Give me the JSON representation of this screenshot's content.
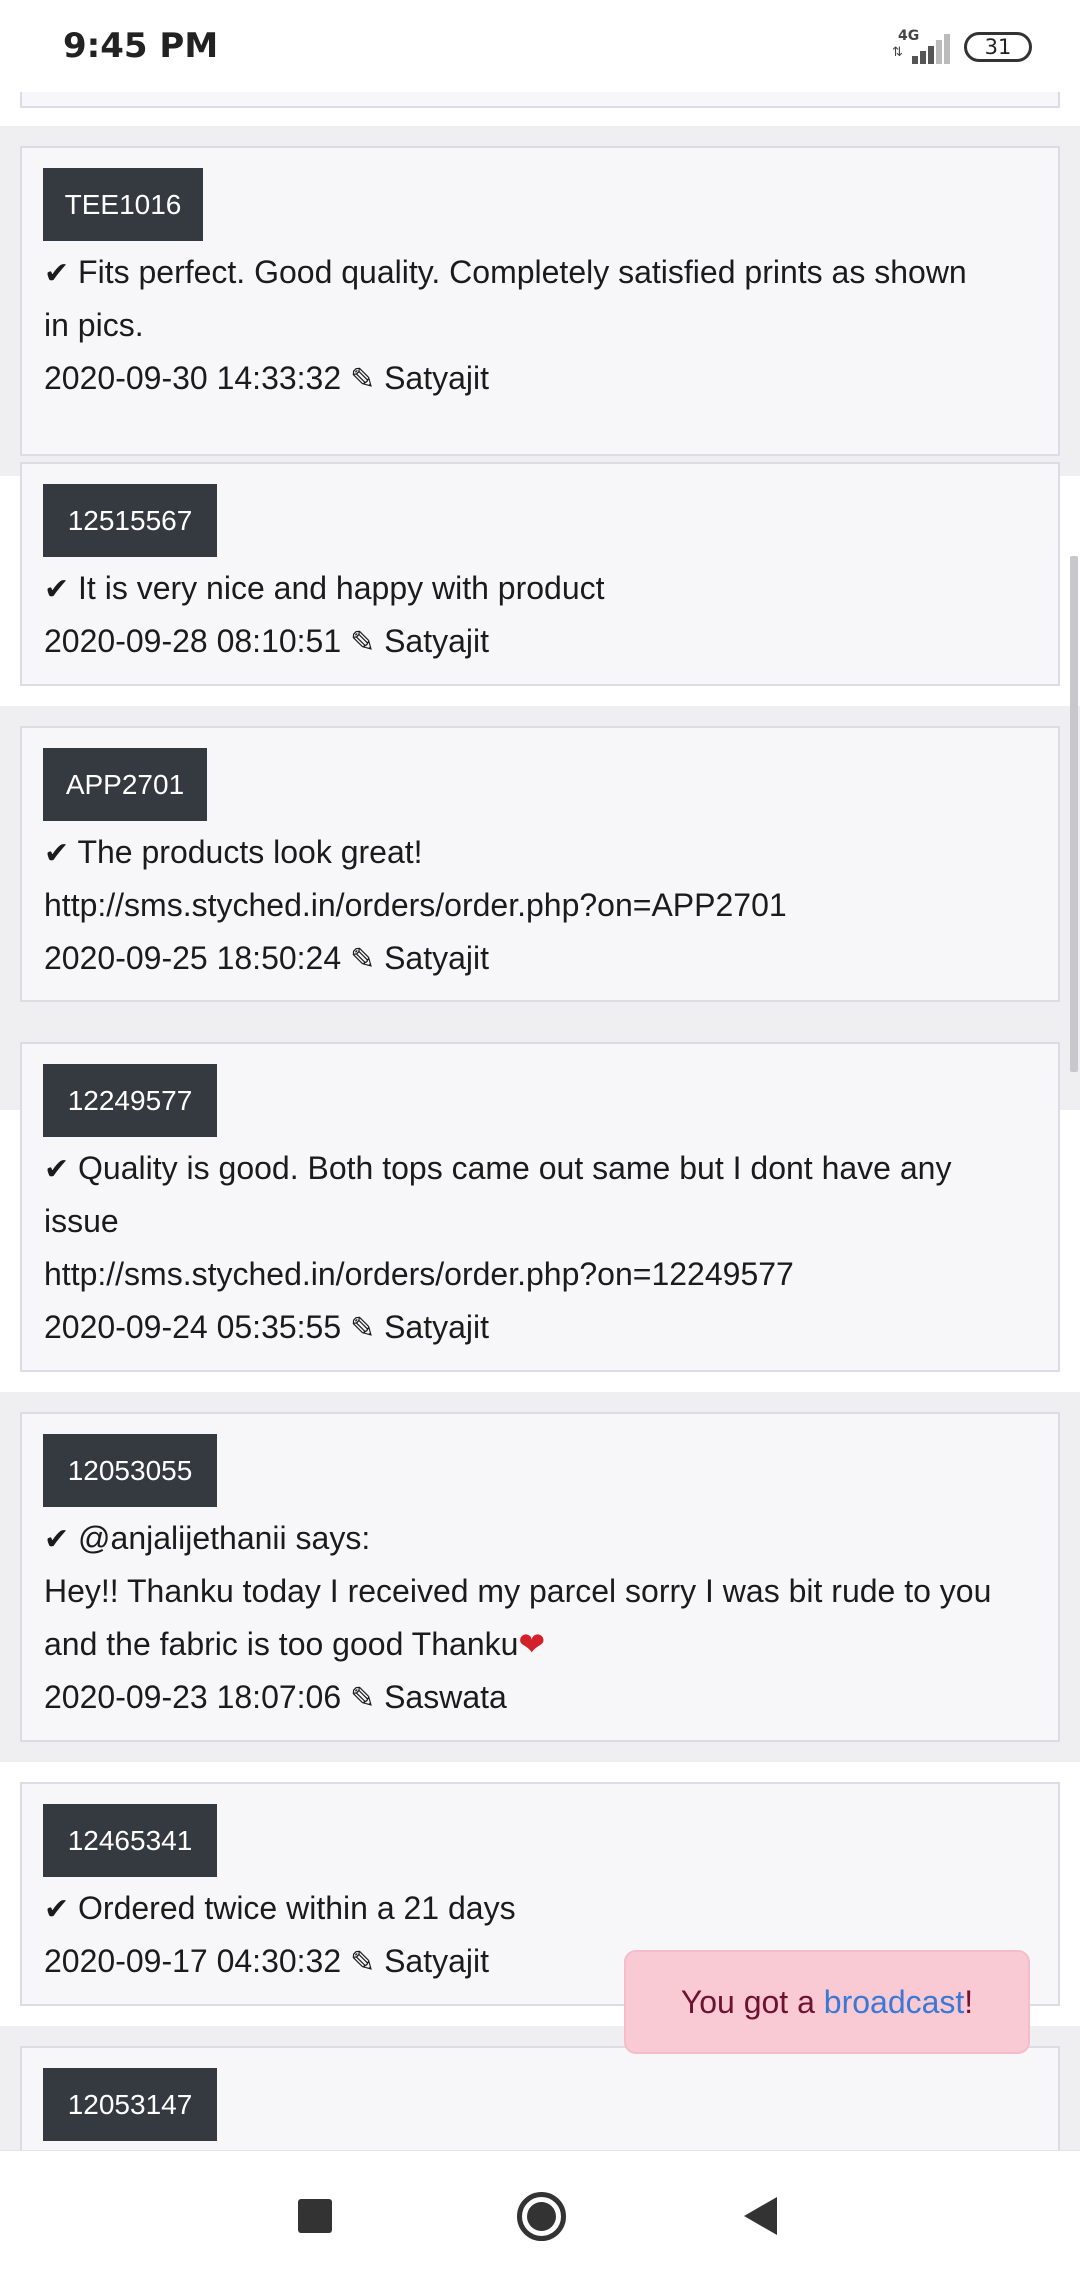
{
  "status_bar": {
    "time": "9:45 PM",
    "network": "4G",
    "battery": "31"
  },
  "reviews": [
    {
      "code": "TEE1016",
      "lines": [
        "Fits perfect. Good quality. Completely satisfied prints as shown",
        "in pics."
      ],
      "timestamp": "2020-09-30 14:33:32",
      "author": "Satyajit"
    },
    {
      "code": "12515567",
      "lines": [
        "It is very nice and happy with product"
      ],
      "timestamp": "2020-09-28 08:10:51",
      "author": "Satyajit"
    },
    {
      "code": "APP2701",
      "lines": [
        "The products look great!",
        "http://sms.styched.in/orders/order.php?on=APP2701"
      ],
      "timestamp": "2020-09-25 18:50:24",
      "author": "Satyajit"
    },
    {
      "code": "12249577",
      "lines": [
        "Quality is good. Both tops came out same but I dont have any",
        "issue",
        "http://sms.styched.in/orders/order.php?on=12249577"
      ],
      "timestamp": "2020-09-24 05:35:55",
      "author": "Satyajit"
    },
    {
      "code": "12053055",
      "lines": [
        "@anjalijethanii says:",
        "Hey!! Thanku today I received my parcel sorry I was bit rude to you",
        "and the fabric is too good Thanku"
      ],
      "timestamp": "2020-09-23 18:07:06",
      "author": "Saswata"
    },
    {
      "code": "12465341",
      "lines": [
        "Ordered twice within a 21 days"
      ],
      "timestamp": "2020-09-17 04:30:32",
      "author": "Satyajit"
    },
    {
      "code": "12053147"
    }
  ],
  "toast": {
    "prefix": "You got a ",
    "link": "broadcast",
    "suffix": "!"
  },
  "icons": {
    "check": "check-icon",
    "pencil": "pencil-icon",
    "heart": "heart-icon"
  }
}
